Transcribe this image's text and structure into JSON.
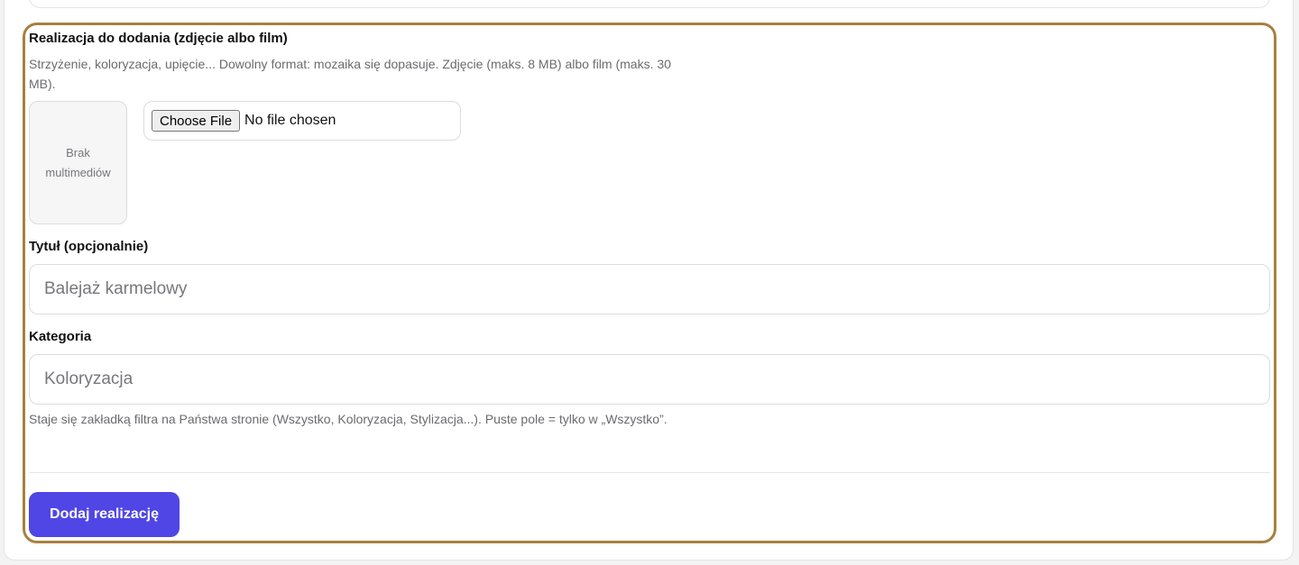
{
  "media_field": {
    "label": "Realizacja do dodania (zdjęcie albo film)",
    "hint": "Strzyżenie, koloryzacja, upięcie... Dowolny format: mozaika się dopasuje. Zdjęcie (maks. 8 MB) albo film (maks. 30 MB).",
    "preview_empty_line1": "Brak",
    "preview_empty_line2": "multimediów",
    "file_button_label": "Choose File",
    "file_status": "No file chosen"
  },
  "title_field": {
    "label": "Tytuł (opcjonalnie)",
    "value": "",
    "placeholder": "Balejaż karmelowy"
  },
  "category_field": {
    "label": "Kategoria",
    "value": "",
    "placeholder": "Koloryzacja",
    "hint": "Staje się zakładką filtra na Państwa stronie (Wszystko, Koloryzacja, Stylizacja...). Puste pole = tylko w „Wszystko”."
  },
  "submit": {
    "label": "Dodaj realizację"
  },
  "colors": {
    "form_border": "#a8803f",
    "primary_button": "#4f46e5"
  }
}
